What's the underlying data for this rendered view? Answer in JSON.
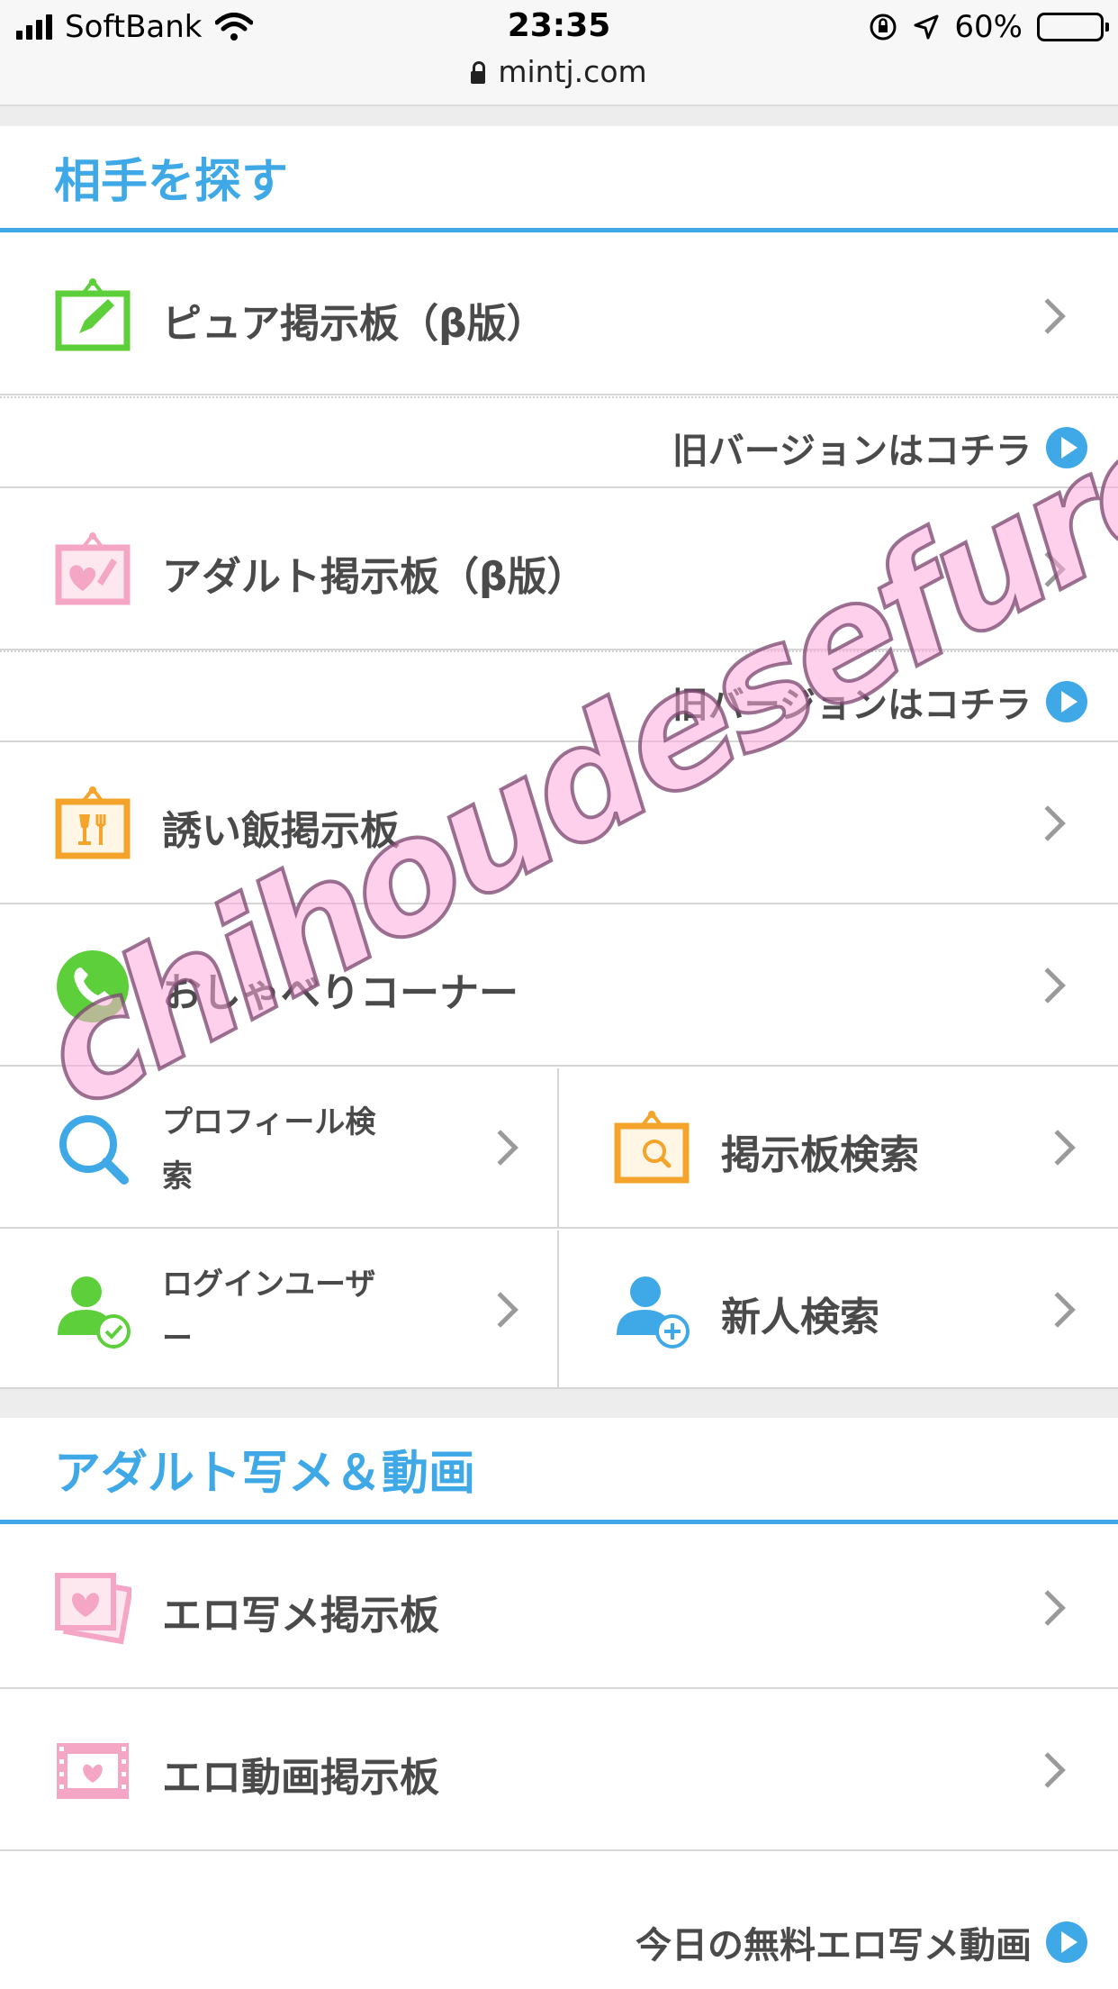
{
  "status_bar": {
    "carrier": "SoftBank",
    "time": "23:35",
    "url": "mintj.com",
    "battery": "60%",
    "battery_level": 0.6
  },
  "section1": {
    "title": "相手を探す",
    "items": [
      {
        "label": "ピュア掲示板（β版）",
        "icon": "green-board-pencil-icon"
      },
      {
        "label": "アダルト掲示板（β版）",
        "icon": "pink-board-heart-icon"
      },
      {
        "label": "誘い飯掲示板",
        "icon": "orange-board-dining-icon"
      },
      {
        "label": "おしゃべりコーナー",
        "icon": "green-phone-icon"
      }
    ],
    "old_version_link": "旧バージョンはコチラ",
    "grid": [
      {
        "label": "プロフィール検索",
        "icon": "blue-search-icon"
      },
      {
        "label": "掲示板検索",
        "icon": "orange-board-search-icon"
      },
      {
        "label": "ログインユーザー",
        "icon": "green-user-check-icon"
      },
      {
        "label": "新人検索",
        "icon": "blue-user-plus-icon"
      }
    ]
  },
  "section2": {
    "title": "アダルト写メ＆動画",
    "items": [
      {
        "label": "エロ写メ掲示板",
        "icon": "pink-photo-heart-icon"
      },
      {
        "label": "エロ動画掲示板",
        "icon": "pink-film-heart-icon"
      }
    ],
    "footer_link": "今日の無料エロ写メ動画"
  },
  "watermark": "chihoudesefureget.net",
  "colors": {
    "accent": "#3fa9e8",
    "green": "#5ccf3a",
    "pink": "#f4a6c4",
    "orange": "#f4a42a"
  }
}
